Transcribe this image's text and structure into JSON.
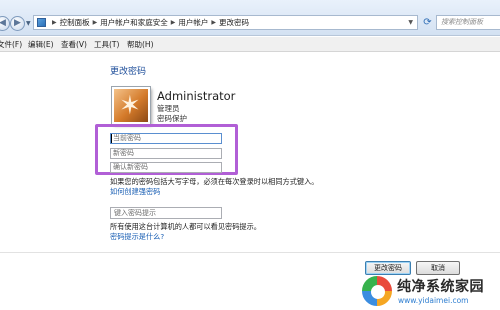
{
  "address_bar": {
    "breadcrumbs": [
      "控制面板",
      "用户帐户和家庭安全",
      "用户帐户",
      "更改密码"
    ],
    "search_placeholder": "搜索控制面板"
  },
  "menu": {
    "file": "文件(F)",
    "edit": "编辑(E)",
    "view": "查看(V)",
    "tools": "工具(T)",
    "help": "帮助(H)"
  },
  "page": {
    "title": "更改密码",
    "account_name": "Administrator",
    "account_type": "管理员",
    "account_status": "密码保护"
  },
  "form": {
    "current_password_placeholder": "当前密码",
    "new_password_placeholder": "新密码",
    "confirm_password_placeholder": "确认新密码",
    "caps_note": "如果您的密码包括大写字母，必须在每次登录时以相同方式键入。",
    "strong_password_link": "如何创建强密码",
    "hint_placeholder": "键入密码提示",
    "hint_note": "所有使用这台计算机的人都可以看见密码提示。",
    "hint_link": "密码提示是什么?"
  },
  "buttons": {
    "change_password": "更改密码",
    "cancel": "取消"
  },
  "watermark": {
    "title": "纯净系统家园",
    "url": "www.yidaimei.com"
  },
  "colors": {
    "accent_link": "#1a5fb4",
    "highlight_box": "#b15fd6"
  }
}
